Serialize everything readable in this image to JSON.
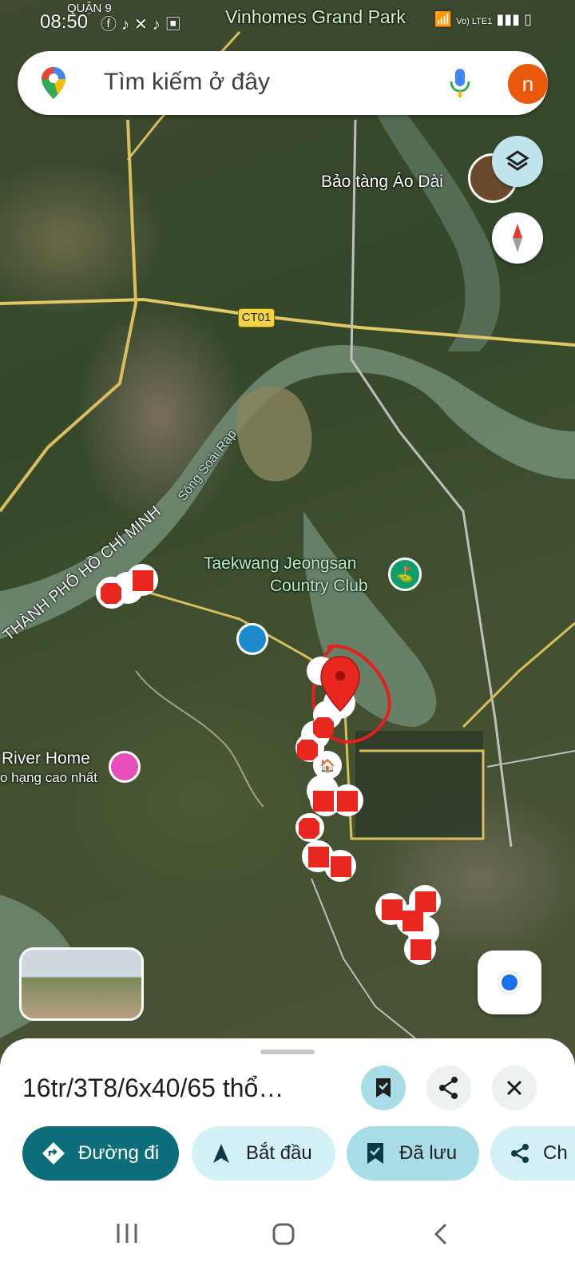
{
  "status_bar": {
    "time": "08:50",
    "top_label": "QUẬN 9",
    "icons": [
      "facebook-icon",
      "tiktok-icon",
      "cross-app-icon",
      "tiktok-icon",
      "samsung-icon",
      "dot-icon"
    ],
    "network": "Vo) LTE1"
  },
  "map": {
    "labels": {
      "vinhomes": "Vinhomes Grand Park",
      "museum": "Bảo tàng Áo Dài",
      "road_ct01": "CT01",
      "river": "Sông Soài Rạp",
      "city": "THÀNH PHỐ HỒ CHÍ MINH",
      "golf_line1": "Taekwang Jeongsan",
      "golf_line2": "Country Club",
      "river_home": "River Home",
      "river_home_sub": "o hạng cao nhất"
    }
  },
  "search": {
    "placeholder": "Tìm kiếm ở đây",
    "avatar_letter": "n"
  },
  "sheet": {
    "title": "16tr/3T8/6x40/65 thổ…",
    "actions": {
      "directions": "Đường đi",
      "start": "Bắt đầu",
      "saved": "Đã lưu",
      "share": "Ch"
    }
  },
  "colors": {
    "primary": "#0b6e7a",
    "chip_bg": "#d3f1f6",
    "saved_bg": "#a8dde8",
    "marker_red": "#e8271f",
    "avatar": "#e8590c"
  }
}
